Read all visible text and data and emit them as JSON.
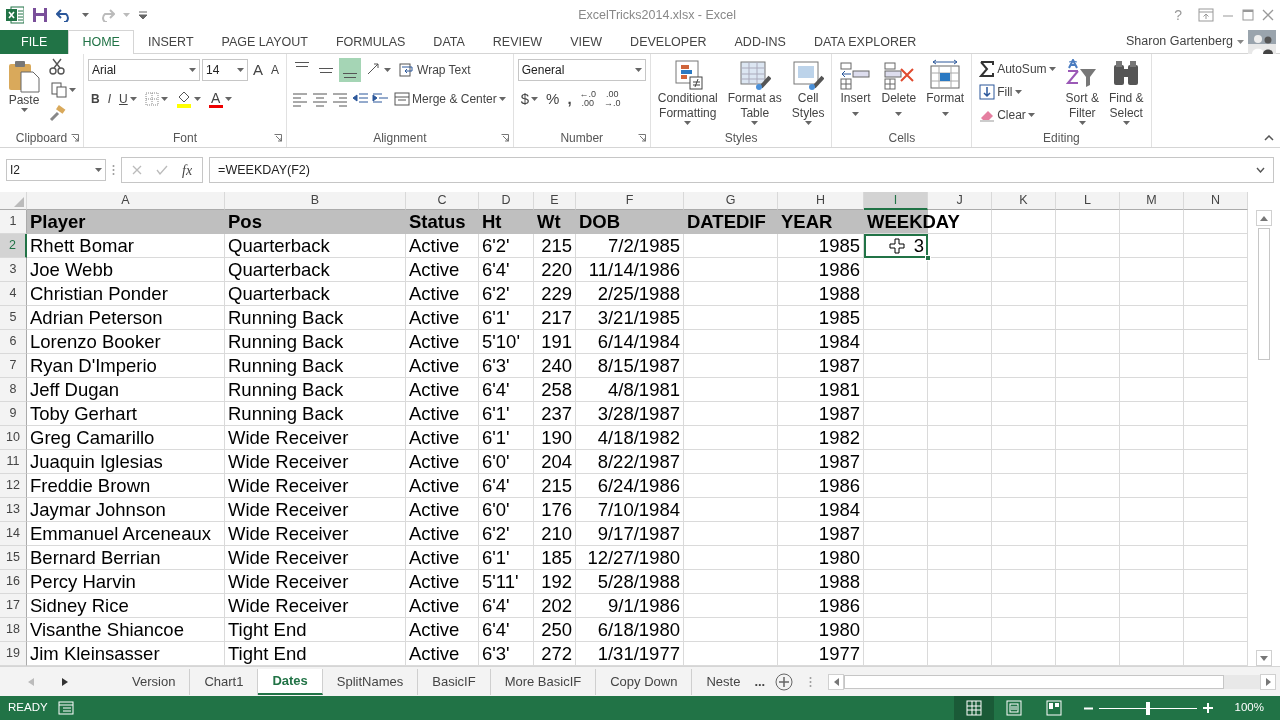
{
  "title_bar": {
    "title": "ExcelTricks2014.xlsx - Excel",
    "help": "?"
  },
  "ribbon_tabs": [
    {
      "label": "FILE",
      "kind": "file",
      "selected": false
    },
    {
      "label": "HOME",
      "kind": "tab",
      "selected": true
    },
    {
      "label": "INSERT",
      "kind": "tab",
      "selected": false
    },
    {
      "label": "PAGE LAYOUT",
      "kind": "tab",
      "selected": false
    },
    {
      "label": "FORMULAS",
      "kind": "tab",
      "selected": false
    },
    {
      "label": "DATA",
      "kind": "tab",
      "selected": false
    },
    {
      "label": "REVIEW",
      "kind": "tab",
      "selected": false
    },
    {
      "label": "VIEW",
      "kind": "tab",
      "selected": false
    },
    {
      "label": "DEVELOPER",
      "kind": "tab",
      "selected": false
    },
    {
      "label": "ADD-INS",
      "kind": "tab",
      "selected": false
    },
    {
      "label": "DATA EXPLORER",
      "kind": "tab",
      "selected": false
    }
  ],
  "user": {
    "name": "Sharon Gartenberg"
  },
  "ribbon_groups": [
    {
      "kind": "clipboard",
      "label": "Clipboard",
      "paste": "Paste"
    },
    {
      "kind": "font",
      "label": "Font",
      "font_name": "Arial",
      "font_size": "14",
      "grow": "A",
      "shrink": "A",
      "bold": "B",
      "italic": "I",
      "underline": "U",
      "font_color": "A"
    },
    {
      "kind": "alignment",
      "label": "Alignment",
      "vertical_align": [
        {
          "selected": false
        },
        {
          "selected": false
        },
        {
          "selected": true
        }
      ],
      "wrap_text": "Wrap Text",
      "merge": "Merge & Center"
    },
    {
      "kind": "number",
      "label": "Number",
      "format": "General",
      "currency": "$",
      "percent": "%",
      "comma": ",",
      "decimal_buttons": [
        {
          "top": "←.0",
          "bottom": ".00"
        },
        {
          "top": ".00",
          "bottom": "→.0"
        }
      ]
    },
    {
      "kind": "styles",
      "label": "Styles",
      "buttons": [
        {
          "lines": [
            "Conditional",
            "Formatting"
          ]
        },
        {
          "lines": [
            "Format as",
            "Table"
          ]
        },
        {
          "lines": [
            "Cell",
            "Styles"
          ]
        }
      ]
    },
    {
      "kind": "cells",
      "label": "Cells",
      "buttons": [
        {
          "lines": [
            "Insert"
          ]
        },
        {
          "lines": [
            "Delete"
          ]
        },
        {
          "lines": [
            "Format"
          ]
        }
      ]
    },
    {
      "kind": "editing",
      "label": "Editing",
      "small": [
        "AutoSum",
        "Fill",
        "Clear"
      ],
      "buttons": [
        {
          "lines": [
            "Sort &",
            "Filter"
          ]
        },
        {
          "lines": [
            "Find &",
            "Select"
          ]
        }
      ]
    }
  ],
  "formula_bar": {
    "name_box": "I2",
    "fx_label": "fx",
    "formula": "=WEEKDAY(F2)"
  },
  "sheet": {
    "columns": [
      {
        "label": "A",
        "selected": false
      },
      {
        "label": "B",
        "selected": false
      },
      {
        "label": "C",
        "selected": false
      },
      {
        "label": "D",
        "selected": false
      },
      {
        "label": "E",
        "selected": false
      },
      {
        "label": "F",
        "selected": false
      },
      {
        "label": "G",
        "selected": false
      },
      {
        "label": "H",
        "selected": false
      },
      {
        "label": "I",
        "selected": true
      },
      {
        "label": "J",
        "selected": false
      },
      {
        "label": "K",
        "selected": false
      },
      {
        "label": "L",
        "selected": false
      },
      {
        "label": "M",
        "selected": false
      },
      {
        "label": "N",
        "selected": false
      }
    ],
    "rows": [
      {
        "number": "1",
        "kind": "header",
        "selected": false,
        "cells": [
          "Player",
          "Pos",
          "Status",
          "Ht",
          "Wt",
          "DOB",
          "DATEDIF",
          "YEAR",
          "WEEKDAY"
        ]
      },
      {
        "number": "2",
        "kind": "data",
        "selected": true,
        "cells": [
          "Rhett Bomar",
          "Quarterback",
          "Active",
          "6'2'",
          "215",
          "7/2/1985",
          null,
          "1985",
          "3"
        ]
      },
      {
        "number": "3",
        "kind": "data",
        "selected": false,
        "cells": [
          "Joe Webb",
          "Quarterback",
          "Active",
          "6'4'",
          "220",
          "11/14/1986",
          null,
          "1986",
          null
        ]
      },
      {
        "number": "4",
        "kind": "data",
        "selected": false,
        "cells": [
          "Christian Ponder",
          "Quarterback",
          "Active",
          "6'2'",
          "229",
          "2/25/1988",
          null,
          "1988",
          null
        ]
      },
      {
        "number": "5",
        "kind": "data",
        "selected": false,
        "cells": [
          "Adrian Peterson",
          "Running Back",
          "Active",
          "6'1'",
          "217",
          "3/21/1985",
          null,
          "1985",
          null
        ]
      },
      {
        "number": "6",
        "kind": "data",
        "selected": false,
        "cells": [
          "Lorenzo Booker",
          "Running Back",
          "Active",
          "5'10'",
          "191",
          "6/14/1984",
          null,
          "1984",
          null
        ]
      },
      {
        "number": "7",
        "kind": "data",
        "selected": false,
        "cells": [
          "Ryan D'Imperio",
          "Running Back",
          "Active",
          "6'3'",
          "240",
          "8/15/1987",
          null,
          "1987",
          null
        ]
      },
      {
        "number": "8",
        "kind": "data",
        "selected": false,
        "cells": [
          "Jeff Dugan",
          "Running Back",
          "Active",
          "6'4'",
          "258",
          "4/8/1981",
          null,
          "1981",
          null
        ]
      },
      {
        "number": "9",
        "kind": "data",
        "selected": false,
        "cells": [
          "Toby Gerhart",
          "Running Back",
          "Active",
          "6'1'",
          "237",
          "3/28/1987",
          null,
          "1987",
          null
        ]
      },
      {
        "number": "10",
        "kind": "data",
        "selected": false,
        "cells": [
          "Greg Camarillo",
          "Wide Receiver",
          "Active",
          "6'1'",
          "190",
          "4/18/1982",
          null,
          "1982",
          null
        ]
      },
      {
        "number": "11",
        "kind": "data",
        "selected": false,
        "cells": [
          "Juaquin Iglesias",
          "Wide Receiver",
          "Active",
          "6'0'",
          "204",
          "8/22/1987",
          null,
          "1987",
          null
        ]
      },
      {
        "number": "12",
        "kind": "data",
        "selected": false,
        "cells": [
          "Freddie Brown",
          "Wide Receiver",
          "Active",
          "6'4'",
          "215",
          "6/24/1986",
          null,
          "1986",
          null
        ]
      },
      {
        "number": "13",
        "kind": "data",
        "selected": false,
        "cells": [
          "Jaymar Johnson",
          "Wide Receiver",
          "Active",
          "6'0'",
          "176",
          "7/10/1984",
          null,
          "1984",
          null
        ]
      },
      {
        "number": "14",
        "kind": "data",
        "selected": false,
        "cells": [
          "Emmanuel Arceneaux",
          "Wide Receiver",
          "Active",
          "6'2'",
          "210",
          "9/17/1987",
          null,
          "1987",
          null
        ]
      },
      {
        "number": "15",
        "kind": "data",
        "selected": false,
        "cells": [
          "Bernard Berrian",
          "Wide Receiver",
          "Active",
          "6'1'",
          "185",
          "12/27/1980",
          null,
          "1980",
          null
        ]
      },
      {
        "number": "16",
        "kind": "data",
        "selected": false,
        "cells": [
          "Percy Harvin",
          "Wide Receiver",
          "Active",
          "5'11'",
          "192",
          "5/28/1988",
          null,
          "1988",
          null
        ]
      },
      {
        "number": "17",
        "kind": "data",
        "selected": false,
        "cells": [
          "Sidney Rice",
          "Wide Receiver",
          "Active",
          "6'4'",
          "202",
          "9/1/1986",
          null,
          "1986",
          null
        ]
      },
      {
        "number": "18",
        "kind": "data",
        "selected": false,
        "cells": [
          "Visanthe Shiancoe",
          "Tight End",
          "Active",
          "6'4'",
          "250",
          "6/18/1980",
          null,
          "1980",
          null
        ]
      },
      {
        "number": "19",
        "kind": "data",
        "selected": false,
        "cells": [
          "Jim Kleinsasser",
          "Tight End",
          "Active",
          "6'3'",
          "272",
          "1/31/1977",
          null,
          "1977",
          null
        ]
      }
    ]
  },
  "sheet_tabs": {
    "tabs": [
      {
        "label": "Version",
        "selected": false
      },
      {
        "label": "Chart1",
        "selected": false
      },
      {
        "label": "Dates",
        "selected": true
      },
      {
        "label": "SplitNames",
        "selected": false
      },
      {
        "label": "BasicIF",
        "selected": false
      },
      {
        "label": "More BasicIF",
        "selected": false
      },
      {
        "label": "Copy Down",
        "selected": false
      },
      {
        "label": "Neste",
        "selected": false
      }
    ],
    "more": "..."
  },
  "status_bar": {
    "mode": "READY",
    "views": [
      {
        "selected": true
      },
      {
        "selected": false
      },
      {
        "selected": false
      }
    ],
    "zoom": {
      "level": 0.5,
      "reading": "100%"
    }
  }
}
